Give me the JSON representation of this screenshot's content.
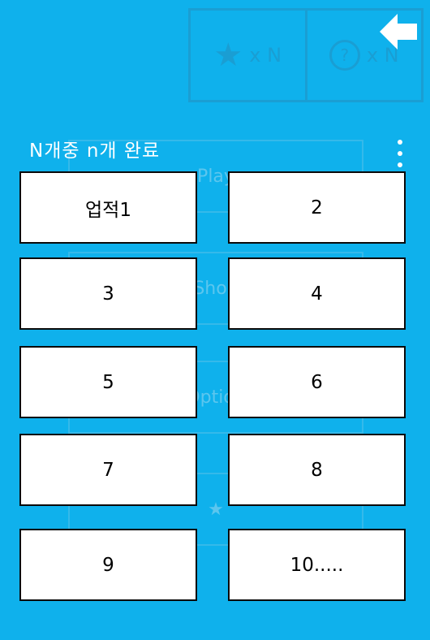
{
  "header": {
    "title": "N개중 n개 완료",
    "back_icon": "arrow-left-icon",
    "more_icon": "more-vertical-icon"
  },
  "background": {
    "stars": {
      "icon": "star-icon",
      "label": "x N"
    },
    "hints": {
      "icon": "question-circle-icon",
      "label": "x N"
    },
    "menu_items": [
      "Play",
      "Shop",
      "Option",
      "★"
    ]
  },
  "achievements": [
    "업적1",
    "2",
    "3",
    "4",
    "5",
    "6",
    "7",
    "8",
    "9",
    "10....."
  ],
  "colors": {
    "background": "#0fb1ec",
    "button_fill": "#ffffff",
    "button_border": "#0a0a0a",
    "title_text": "#ffffff"
  }
}
